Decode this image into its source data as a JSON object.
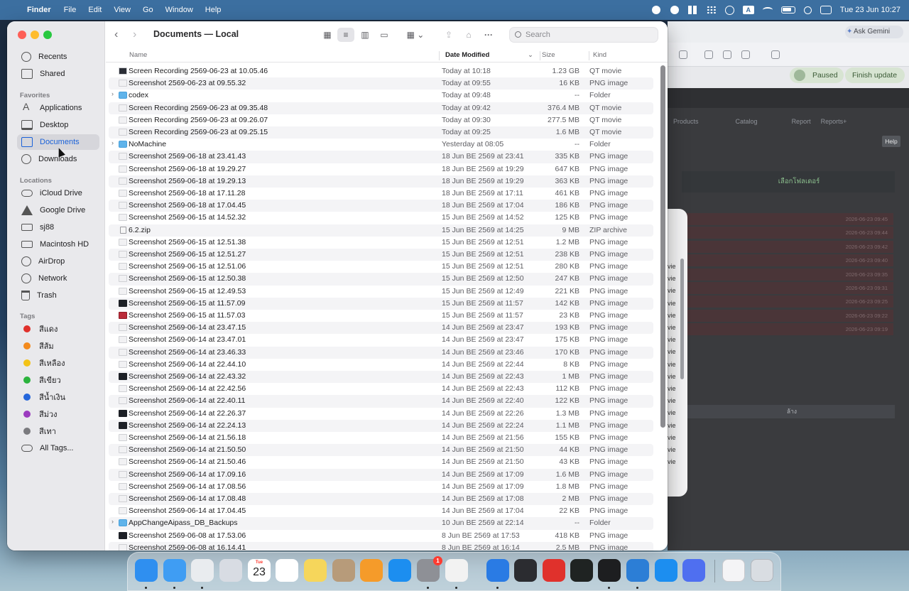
{
  "menubar": {
    "app": "Finder",
    "menus": [
      "File",
      "Edit",
      "View",
      "Go",
      "Window",
      "Help"
    ],
    "clock": "Tue 23 Jun  10:27",
    "status_icons": [
      "record-icon",
      "creative-cloud-icon",
      "windows-grid-icon",
      "dots-grid-icon",
      "play-circle-icon",
      "input-source-icon",
      "wifi-icon",
      "battery-icon",
      "spotlight-icon",
      "control-center-icon"
    ],
    "input_source": "A"
  },
  "background_browser": {
    "ask_gemini": "Ask Gemini",
    "paused": "Paused",
    "finish_update": "Finish update",
    "nav": [
      "Products",
      "Catalog",
      "Report",
      "Reports+"
    ],
    "help": "Help",
    "pick_folder": "เลือกโฟลเดอร์",
    "row_dates": [
      "2026-06-23 09:45",
      "2026-06-23 09:44",
      "2026-06-23 09:42",
      "2026-06-23 09:40",
      "2026-06-23 09:35",
      "2026-06-23 09:31",
      "2026-06-23 09:25",
      "2026-06-23 09:22",
      "2026-06-23 09:19"
    ],
    "clear": "ล้าง",
    "sheet_fragments": [
      "vie",
      "vie",
      "vie",
      "vie",
      "vie",
      "vie",
      "vie",
      "vie",
      "vie",
      "vie",
      "vie",
      "vie",
      "vie",
      "vie",
      "vie",
      "vie",
      "vie"
    ]
  },
  "finder": {
    "title": "Documents — Local",
    "search_placeholder": "Search",
    "columns": {
      "name": "Name",
      "date": "Date Modified",
      "size": "Size",
      "kind": "Kind"
    },
    "sidebar": {
      "recents": "Recents",
      "shared": "Shared",
      "favorites_head": "Favorites",
      "favorites": [
        "Applications",
        "Desktop",
        "Documents",
        "Downloads"
      ],
      "locations_head": "Locations",
      "locations": [
        "iCloud Drive",
        "Google Drive",
        "sj88",
        "Macintosh HD",
        "AirDrop",
        "Network",
        "Trash"
      ],
      "tags_head": "Tags",
      "tags": [
        {
          "label": "สีแดง",
          "color": "#e0312c"
        },
        {
          "label": "สีส้ม",
          "color": "#f38a1d"
        },
        {
          "label": "สีเหลือง",
          "color": "#f3c318"
        },
        {
          "label": "สีเขียว",
          "color": "#2bb33d"
        },
        {
          "label": "สีน้ำเงิน",
          "color": "#2566db"
        },
        {
          "label": "สีม่วง",
          "color": "#9b3bbf"
        },
        {
          "label": "สีเทา",
          "color": "#7a7a7e"
        }
      ],
      "all_tags": "All Tags..."
    },
    "files": [
      {
        "name": "Screen Recording 2569-06-23 at 10.05.46",
        "date": "Today at 10:18",
        "size": "1.23 GB",
        "kind": "QT movie",
        "thumb": "movie"
      },
      {
        "name": "Screenshot 2569-06-23 at 09.55.32",
        "date": "Today at 09:55",
        "size": "16 KB",
        "kind": "PNG image",
        "thumb": "light"
      },
      {
        "name": "codex",
        "date": "Today at 09:48",
        "size": "--",
        "kind": "Folder",
        "thumb": "folder"
      },
      {
        "name": "Screen Recording 2569-06-23 at 09.35.48",
        "date": "Today at 09:42",
        "size": "376.4 MB",
        "kind": "QT movie",
        "thumb": "light"
      },
      {
        "name": "Screen Recording 2569-06-23 at 09.26.07",
        "date": "Today at 09:30",
        "size": "277.5 MB",
        "kind": "QT movie",
        "thumb": "light"
      },
      {
        "name": "Screen Recording 2569-06-23 at 09.25.15",
        "date": "Today at 09:25",
        "size": "1.6 MB",
        "kind": "QT movie",
        "thumb": "light"
      },
      {
        "name": "NoMachine",
        "date": "Yesterday at 08:05",
        "size": "--",
        "kind": "Folder",
        "thumb": "folder"
      },
      {
        "name": "Screenshot 2569-06-18 at 23.41.43",
        "date": "18 Jun BE 2569 at 23:41",
        "size": "335 KB",
        "kind": "PNG image",
        "thumb": "light"
      },
      {
        "name": "Screenshot 2569-06-18 at 19.29.27",
        "date": "18 Jun BE 2569 at 19:29",
        "size": "647 KB",
        "kind": "PNG image",
        "thumb": "light"
      },
      {
        "name": "Screenshot 2569-06-18 at 19.29.13",
        "date": "18 Jun BE 2569 at 19:29",
        "size": "363 KB",
        "kind": "PNG image",
        "thumb": "light"
      },
      {
        "name": "Screenshot 2569-06-18 at 17.11.28",
        "date": "18 Jun BE 2569 at 17:11",
        "size": "461 KB",
        "kind": "PNG image",
        "thumb": "light"
      },
      {
        "name": "Screenshot 2569-06-18 at 17.04.45",
        "date": "18 Jun BE 2569 at 17:04",
        "size": "186 KB",
        "kind": "PNG image",
        "thumb": "light"
      },
      {
        "name": "Screenshot 2569-06-15 at 14.52.32",
        "date": "15 Jun BE 2569 at 14:52",
        "size": "125 KB",
        "kind": "PNG image",
        "thumb": "light"
      },
      {
        "name": "6.2.zip",
        "date": "15 Jun BE 2569 at 14:25",
        "size": "9 MB",
        "kind": "ZIP archive",
        "thumb": "zip"
      },
      {
        "name": "Screenshot 2569-06-15 at 12.51.38",
        "date": "15 Jun BE 2569 at 12:51",
        "size": "1.2 MB",
        "kind": "PNG image",
        "thumb": "light"
      },
      {
        "name": "Screenshot 2569-06-15 at 12.51.27",
        "date": "15 Jun BE 2569 at 12:51",
        "size": "238 KB",
        "kind": "PNG image",
        "thumb": "light"
      },
      {
        "name": "Screenshot 2569-06-15 at 12.51.06",
        "date": "15 Jun BE 2569 at 12:51",
        "size": "280 KB",
        "kind": "PNG image",
        "thumb": "light"
      },
      {
        "name": "Screenshot 2569-06-15 at 12.50.38",
        "date": "15 Jun BE 2569 at 12:50",
        "size": "247 KB",
        "kind": "PNG image",
        "thumb": "light"
      },
      {
        "name": "Screenshot 2569-06-15 at 12.49.53",
        "date": "15 Jun BE 2569 at 12:49",
        "size": "221 KB",
        "kind": "PNG image",
        "thumb": "light"
      },
      {
        "name": "Screenshot 2569-06-15 at 11.57.09",
        "date": "15 Jun BE 2569 at 11:57",
        "size": "142 KB",
        "kind": "PNG image",
        "thumb": "dark"
      },
      {
        "name": "Screenshot 2569-06-15 at 11.57.03",
        "date": "15 Jun BE 2569 at 11:57",
        "size": "23 KB",
        "kind": "PNG image",
        "thumb": "red"
      },
      {
        "name": "Screenshot 2569-06-14 at 23.47.15",
        "date": "14 Jun BE 2569 at 23:47",
        "size": "193 KB",
        "kind": "PNG image",
        "thumb": "light"
      },
      {
        "name": "Screenshot 2569-06-14 at 23.47.01",
        "date": "14 Jun BE 2569 at 23:47",
        "size": "175 KB",
        "kind": "PNG image",
        "thumb": "light"
      },
      {
        "name": "Screenshot 2569-06-14 at 23.46.33",
        "date": "14 Jun BE 2569 at 23:46",
        "size": "170 KB",
        "kind": "PNG image",
        "thumb": "light"
      },
      {
        "name": "Screenshot 2569-06-14 at 22.44.10",
        "date": "14 Jun BE 2569 at 22:44",
        "size": "8 KB",
        "kind": "PNG image",
        "thumb": "light"
      },
      {
        "name": "Screenshot 2569-06-14 at 22.43.32",
        "date": "14 Jun BE 2569 at 22:43",
        "size": "1 MB",
        "kind": "PNG image",
        "thumb": "dark"
      },
      {
        "name": "Screenshot 2569-06-14 at 22.42.56",
        "date": "14 Jun BE 2569 at 22:43",
        "size": "112 KB",
        "kind": "PNG image",
        "thumb": "light"
      },
      {
        "name": "Screenshot 2569-06-14 at 22.40.11",
        "date": "14 Jun BE 2569 at 22:40",
        "size": "122 KB",
        "kind": "PNG image",
        "thumb": "light"
      },
      {
        "name": "Screenshot 2569-06-14 at 22.26.37",
        "date": "14 Jun BE 2569 at 22:26",
        "size": "1.3 MB",
        "kind": "PNG image",
        "thumb": "dark"
      },
      {
        "name": "Screenshot 2569-06-14 at 22.24.13",
        "date": "14 Jun BE 2569 at 22:24",
        "size": "1.1 MB",
        "kind": "PNG image",
        "thumb": "dark"
      },
      {
        "name": "Screenshot 2569-06-14 at 21.56.18",
        "date": "14 Jun BE 2569 at 21:56",
        "size": "155 KB",
        "kind": "PNG image",
        "thumb": "light"
      },
      {
        "name": "Screenshot 2569-06-14 at 21.50.50",
        "date": "14 Jun BE 2569 at 21:50",
        "size": "44 KB",
        "kind": "PNG image",
        "thumb": "light"
      },
      {
        "name": "Screenshot 2569-06-14 at 21.50.46",
        "date": "14 Jun BE 2569 at 21:50",
        "size": "43 KB",
        "kind": "PNG image",
        "thumb": "light"
      },
      {
        "name": "Screenshot 2569-06-14 at 17.09.16",
        "date": "14 Jun BE 2569 at 17:09",
        "size": "1.6 MB",
        "kind": "PNG image",
        "thumb": "light"
      },
      {
        "name": "Screenshot 2569-06-14 at 17.08.56",
        "date": "14 Jun BE 2569 at 17:09",
        "size": "1.8 MB",
        "kind": "PNG image",
        "thumb": "light"
      },
      {
        "name": "Screenshot 2569-06-14 at 17.08.48",
        "date": "14 Jun BE 2569 at 17:08",
        "size": "2 MB",
        "kind": "PNG image",
        "thumb": "light"
      },
      {
        "name": "Screenshot 2569-06-14 at 17.04.45",
        "date": "14 Jun BE 2569 at 17:04",
        "size": "22 KB",
        "kind": "PNG image",
        "thumb": "light"
      },
      {
        "name": "AppChangeAipass_DB_Backups",
        "date": "10 Jun BE 2569 at 22:14",
        "size": "--",
        "kind": "Folder",
        "thumb": "folder"
      },
      {
        "name": "Screenshot 2569-06-08 at 17.53.06",
        "date": "8 Jun BE 2569 at 17:53",
        "size": "418 KB",
        "kind": "PNG image",
        "thumb": "dark"
      },
      {
        "name": "Screenshot 2569-06-08 at 16.14.41",
        "date": "8 Jun BE 2569 at 16:14",
        "size": "2.5 MB",
        "kind": "PNG image",
        "thumb": "light"
      }
    ]
  },
  "dock": {
    "apps": [
      {
        "name": "finder",
        "color": "#2f8ff0"
      },
      {
        "name": "safari",
        "color": "#3f9df3"
      },
      {
        "name": "chrome",
        "color": "#e9ecef"
      },
      {
        "name": "launchpad",
        "color": "#d8dce3"
      },
      {
        "name": "calendar",
        "color": "#ffffff"
      },
      {
        "name": "reminders",
        "color": "#ffffff"
      },
      {
        "name": "notes",
        "color": "#f6d65b"
      },
      {
        "name": "contacts",
        "color": "#b79b7a"
      },
      {
        "name": "pages",
        "color": "#f59b2a"
      },
      {
        "name": "app-store",
        "color": "#1c8ef0"
      },
      {
        "name": "system-settings",
        "color": "#8e9096"
      },
      {
        "name": "character-app",
        "color": "#f2f2f2"
      },
      {
        "name": "windows-app",
        "color": "#2a7be4"
      },
      {
        "name": "grid-launcher",
        "color": "#2b2c30"
      },
      {
        "name": "mi-app",
        "color": "#e0312c"
      },
      {
        "name": "activity-monitor",
        "color": "#1f2322"
      },
      {
        "name": "terminal",
        "color": "#1d1e20"
      },
      {
        "name": "vs-code",
        "color": "#2c7ed6"
      },
      {
        "name": "qt-app",
        "color": "#1c8ef0"
      },
      {
        "name": "remote-app",
        "color": "#4f6ff0"
      }
    ],
    "calendar_month": "Tue",
    "calendar_day": "23",
    "settings_badge": "1"
  }
}
